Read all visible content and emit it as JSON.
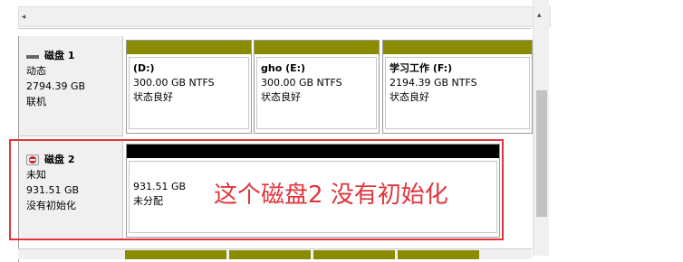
{
  "disks": [
    {
      "title": "磁盘 1",
      "type": "动态",
      "size": "2794.39 GB",
      "status": "联机",
      "icon": "disk-icon",
      "partitions": [
        {
          "name": "(D:)",
          "size_fs": "300.00 GB NTFS",
          "status": "状态良好"
        },
        {
          "name": "gho  (E:)",
          "size_fs": "300.00 GB NTFS",
          "status": "状态良好"
        },
        {
          "name": "学习工作  (F:)",
          "size_fs": "2194.39 GB NTFS",
          "status": "状态良好"
        }
      ]
    },
    {
      "title": "磁盘 2",
      "type": "未知",
      "size": "931.51 GB",
      "status": "没有初始化",
      "icon": "uninitialized-disk-icon",
      "partitions": [
        {
          "size": "931.51 GB",
          "status": "未分配"
        }
      ]
    }
  ],
  "annotation": "这个磁盘2 没有初始化",
  "colors": {
    "partition_bar": "#8b8b00",
    "unallocated_bar": "#000000",
    "annotation": "#e0353b"
  }
}
